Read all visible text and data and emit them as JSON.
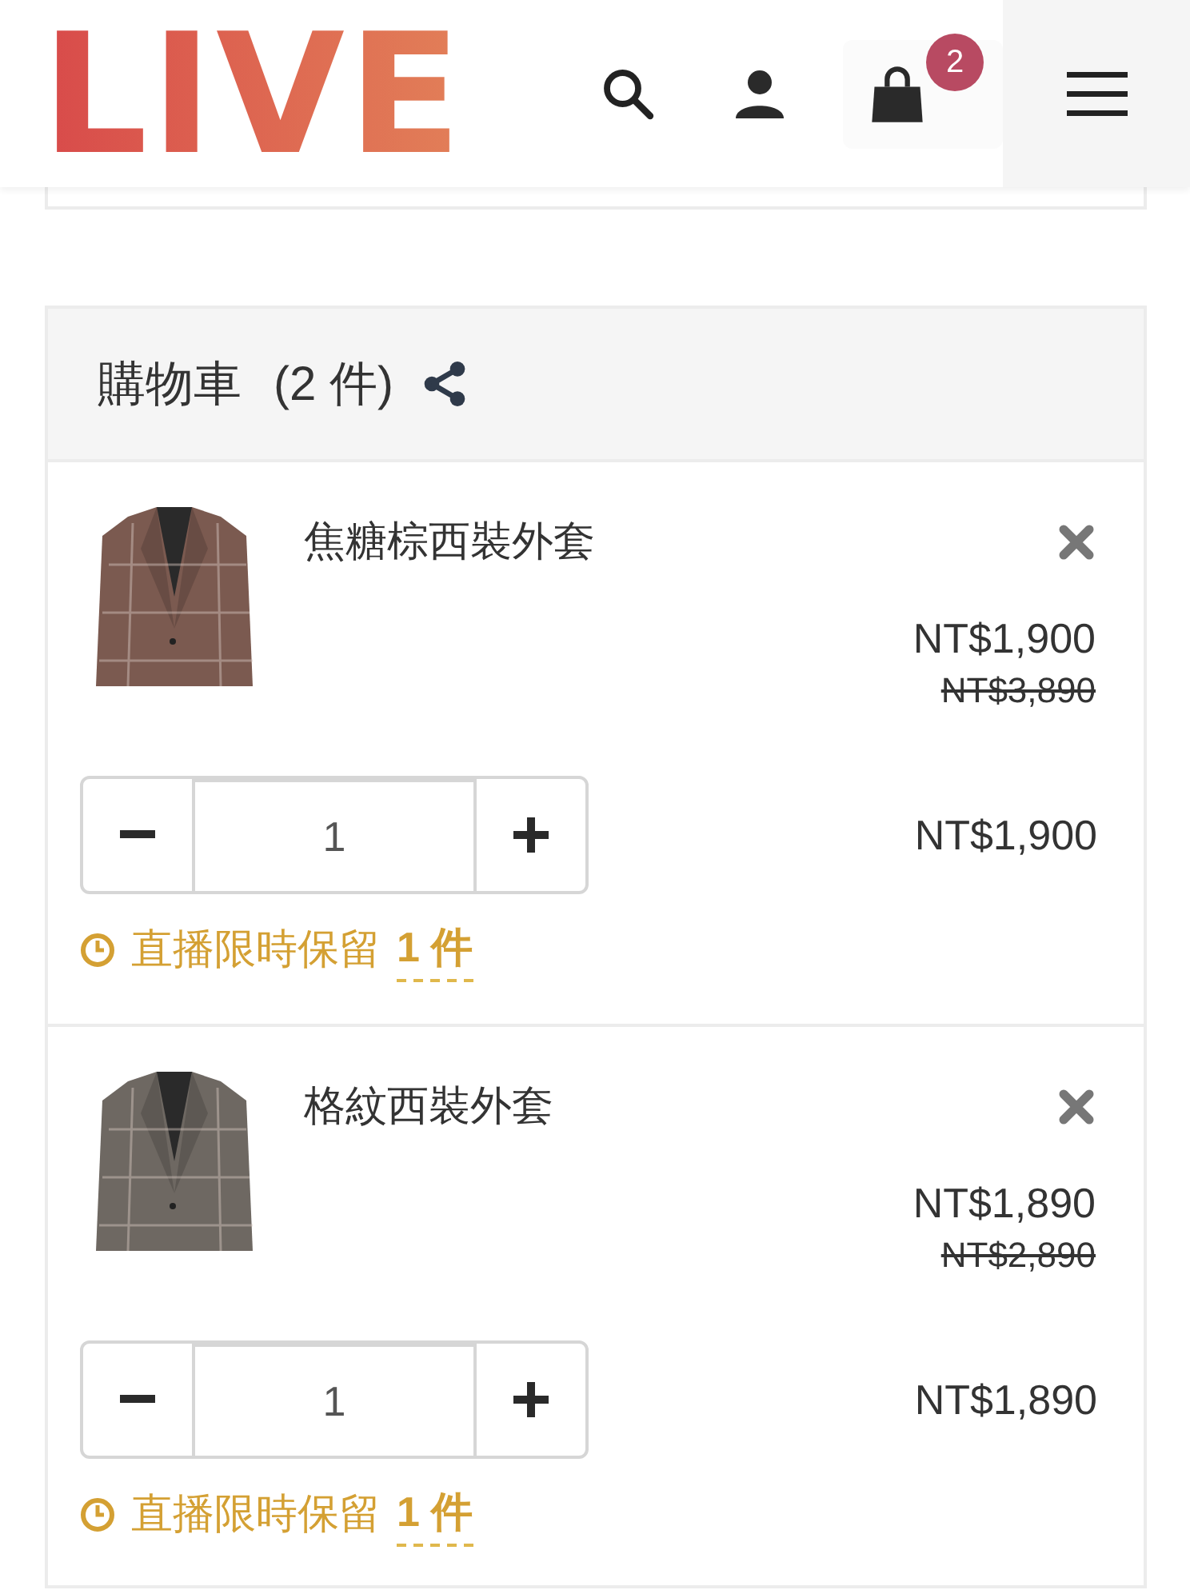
{
  "header": {
    "logo": "LIVE",
    "cart_badge": "2"
  },
  "cart": {
    "title": "購物車",
    "count": "(2 件)",
    "items": [
      {
        "name": "焦糖棕西裝外套",
        "price": "NT$1,900",
        "original_price": "NT$3,890",
        "quantity": "1",
        "subtotal": "NT$1,900",
        "hold_label": "直播限時保留",
        "hold_count": "1 件"
      },
      {
        "name": "格紋西裝外套",
        "price": "NT$1,890",
        "original_price": "NT$2,890",
        "quantity": "1",
        "subtotal": "NT$1,890",
        "hold_label": "直播限時保留",
        "hold_count": "1 件"
      }
    ]
  }
}
